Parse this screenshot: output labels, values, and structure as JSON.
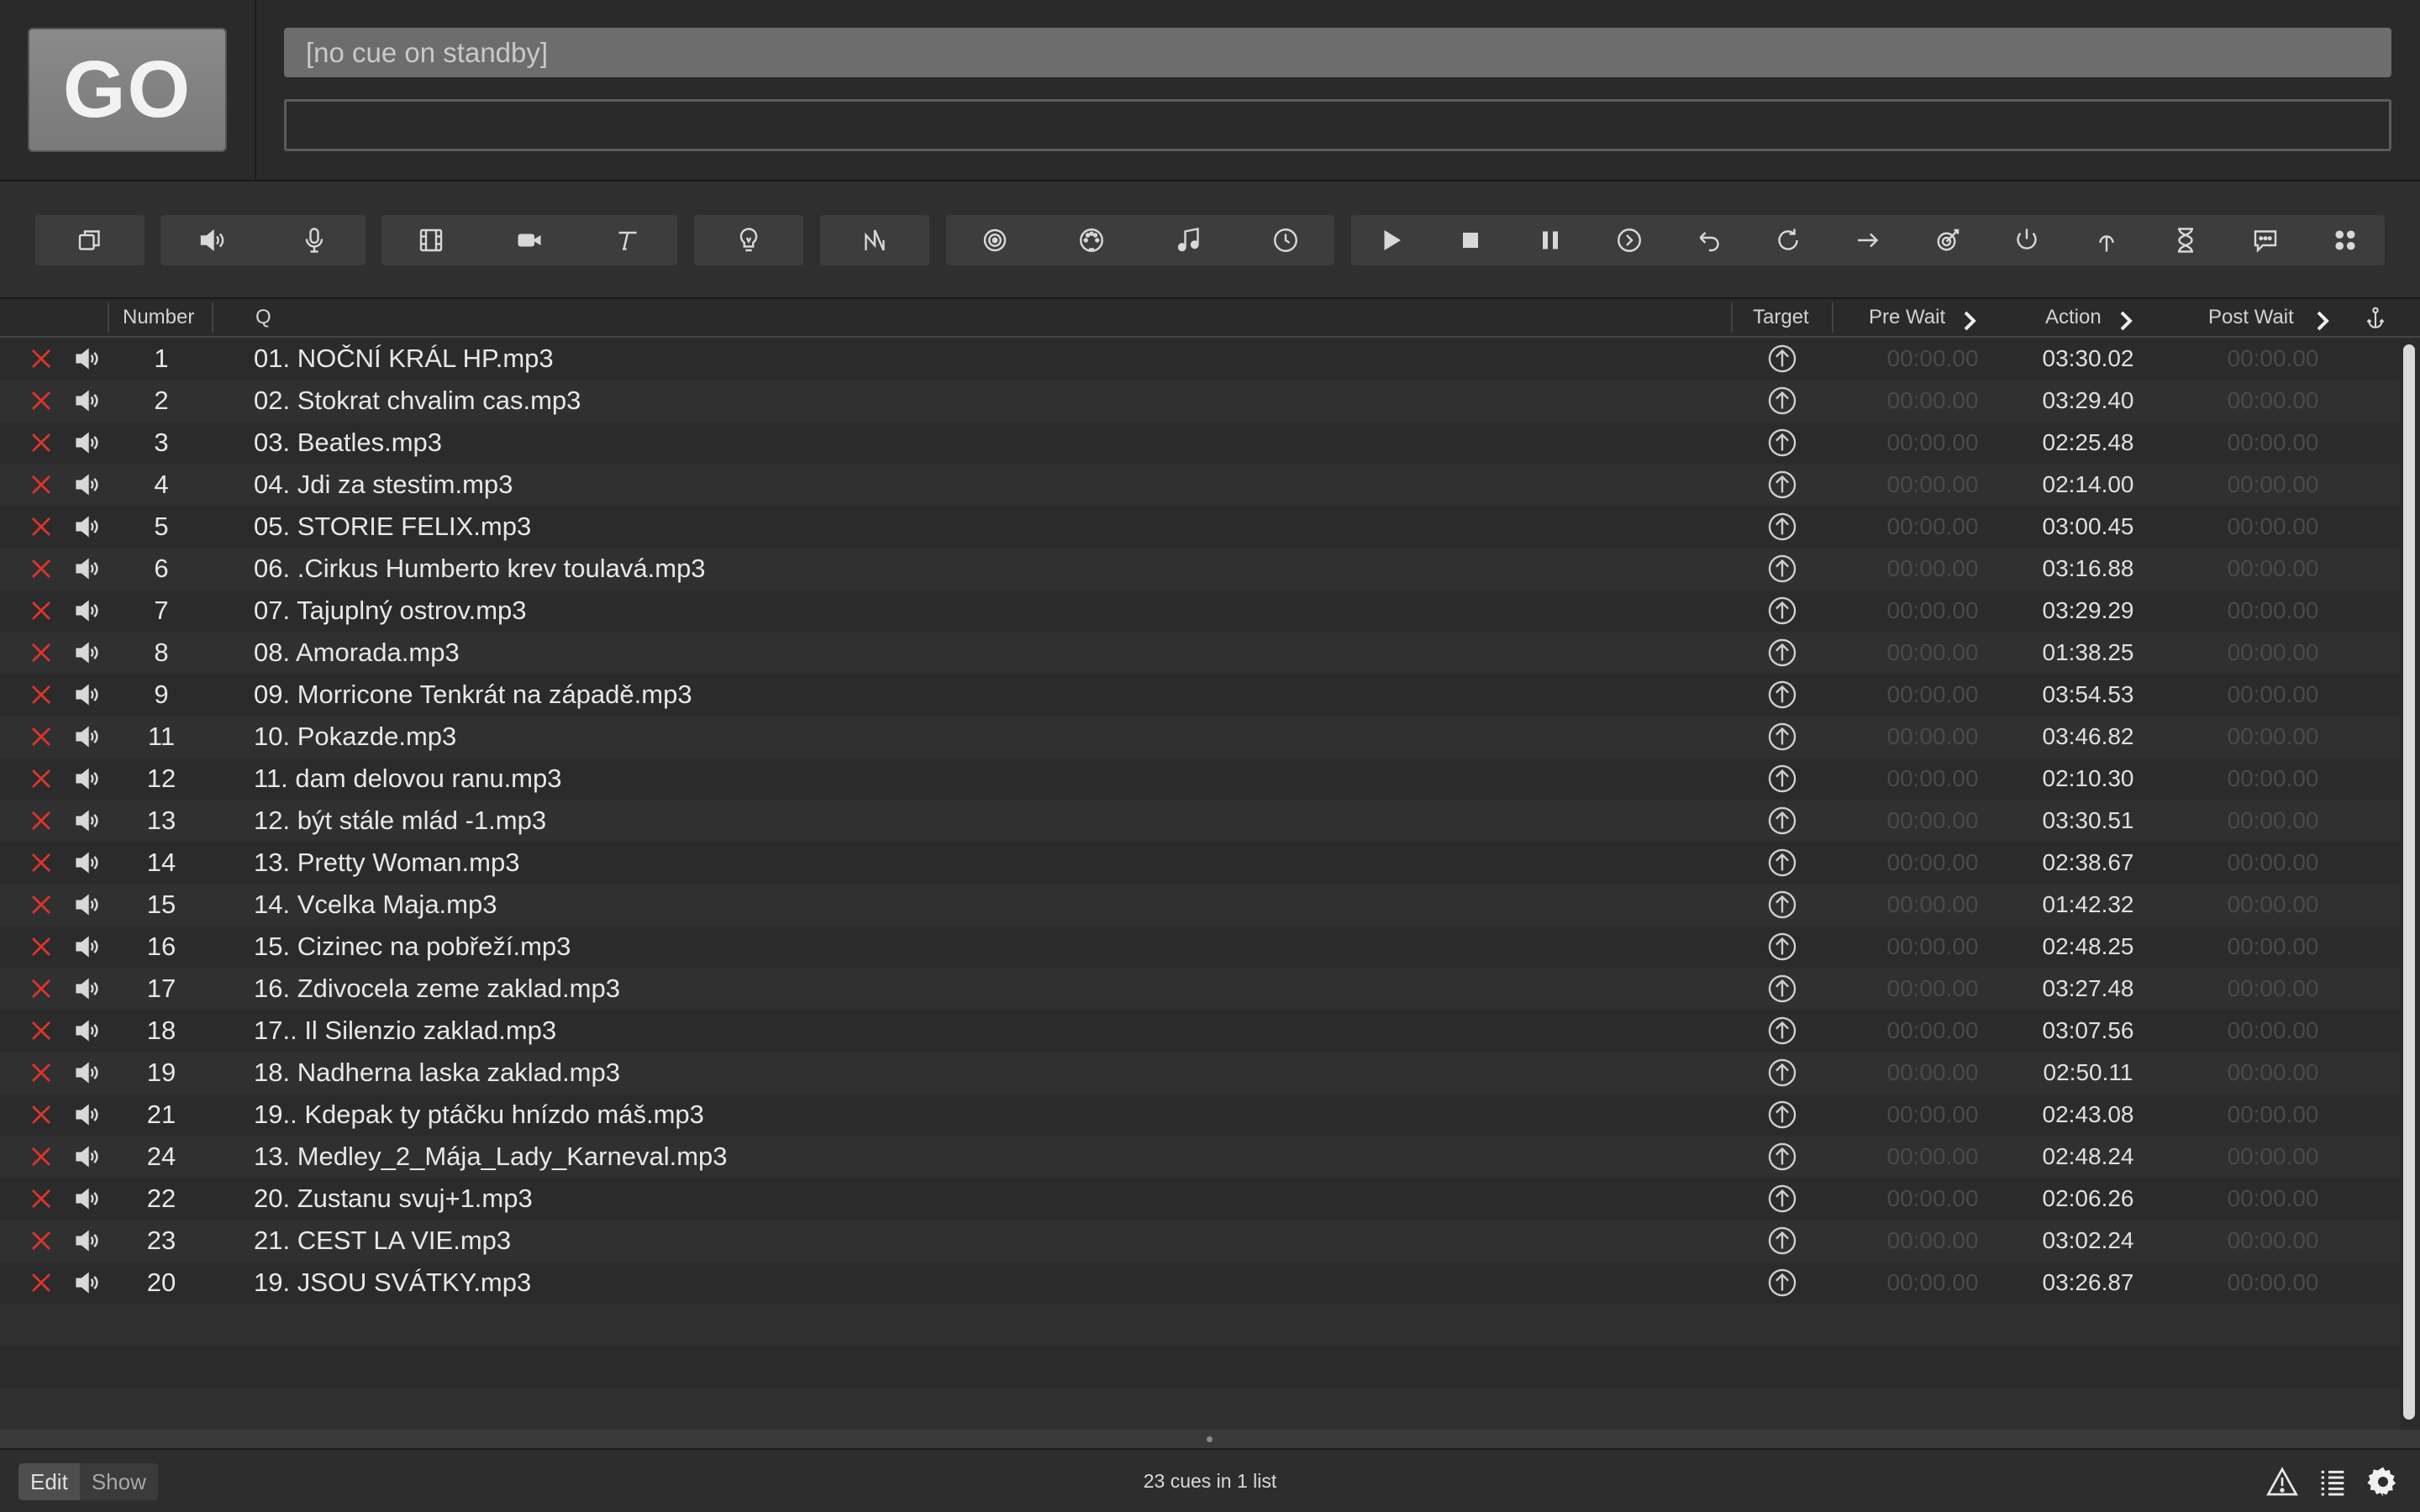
{
  "go_label": "GO",
  "standby_text": "[no cue on standby]",
  "notes_value": "",
  "columns": {
    "number": "Number",
    "q": "Q",
    "target": "Target",
    "prewait": "Pre Wait",
    "action": "Action",
    "postwait": "Post Wait"
  },
  "cues": [
    {
      "number": "1",
      "q": "01. NOČNÍ KRÁL HP.mp3",
      "prewait": "00:00.00",
      "action": "03:30.02",
      "postwait": "00:00.00"
    },
    {
      "number": "2",
      "q": "02. Stokrat chvalim cas.mp3",
      "prewait": "00:00.00",
      "action": "03:29.40",
      "postwait": "00:00.00"
    },
    {
      "number": "3",
      "q": "03. Beatles.mp3",
      "prewait": "00:00.00",
      "action": "02:25.48",
      "postwait": "00:00.00"
    },
    {
      "number": "4",
      "q": "04. Jdi za stestim.mp3",
      "prewait": "00:00.00",
      "action": "02:14.00",
      "postwait": "00:00.00"
    },
    {
      "number": "5",
      "q": "05. STORIE FELIX.mp3",
      "prewait": "00:00.00",
      "action": "03:00.45",
      "postwait": "00:00.00"
    },
    {
      "number": "6",
      "q": "06. .Cirkus Humberto krev toulavá.mp3",
      "prewait": "00:00.00",
      "action": "03:16.88",
      "postwait": "00:00.00"
    },
    {
      "number": "7",
      "q": "07. Tajuplný ostrov.mp3",
      "prewait": "00:00.00",
      "action": "03:29.29",
      "postwait": "00:00.00"
    },
    {
      "number": "8",
      "q": "08. Amorada.mp3",
      "prewait": "00:00.00",
      "action": "01:38.25",
      "postwait": "00:00.00"
    },
    {
      "number": "9",
      "q": "09. Morricone Tenkrát na západě.mp3",
      "prewait": "00:00.00",
      "action": "03:54.53",
      "postwait": "00:00.00"
    },
    {
      "number": "11",
      "q": "10. Pokazde.mp3",
      "prewait": "00:00.00",
      "action": "03:46.82",
      "postwait": "00:00.00"
    },
    {
      "number": "12",
      "q": "11. dam delovou ranu.mp3",
      "prewait": "00:00.00",
      "action": "02:10.30",
      "postwait": "00:00.00"
    },
    {
      "number": "13",
      "q": "12. být stále mlád -1.mp3",
      "prewait": "00:00.00",
      "action": "03:30.51",
      "postwait": "00:00.00"
    },
    {
      "number": "14",
      "q": "13. Pretty Woman.mp3",
      "prewait": "00:00.00",
      "action": "02:38.67",
      "postwait": "00:00.00"
    },
    {
      "number": "15",
      "q": "14. Vcelka Maja.mp3",
      "prewait": "00:00.00",
      "action": "01:42.32",
      "postwait": "00:00.00"
    },
    {
      "number": "16",
      "q": "15. Cizinec na pobřeží.mp3",
      "prewait": "00:00.00",
      "action": "02:48.25",
      "postwait": "00:00.00"
    },
    {
      "number": "17",
      "q": "16. Zdivocela zeme zaklad.mp3",
      "prewait": "00:00.00",
      "action": "03:27.48",
      "postwait": "00:00.00"
    },
    {
      "number": "18",
      "q": "17.. Il Silenzio zaklad.mp3",
      "prewait": "00:00.00",
      "action": "03:07.56",
      "postwait": "00:00.00"
    },
    {
      "number": "19",
      "q": "18. Nadherna laska zaklad.mp3",
      "prewait": "00:00.00",
      "action": "02:50.11",
      "postwait": "00:00.00"
    },
    {
      "number": "21",
      "q": "19.. Kdepak ty ptáčku hnízdo máš.mp3",
      "prewait": "00:00.00",
      "action": "02:43.08",
      "postwait": "00:00.00"
    },
    {
      "number": "24",
      "q": "13. Medley_2_Mája_Lady_Karneval.mp3",
      "prewait": "00:00.00",
      "action": "02:48.24",
      "postwait": "00:00.00"
    },
    {
      "number": "22",
      "q": "20. Zustanu svuj+1.mp3",
      "prewait": "00:00.00",
      "action": "02:06.26",
      "postwait": "00:00.00"
    },
    {
      "number": "23",
      "q": "21. CEST LA VIE.mp3",
      "prewait": "00:00.00",
      "action": "03:02.24",
      "postwait": "00:00.00"
    },
    {
      "number": "20",
      "q": "19. JSOU SVÁTKY.mp3",
      "prewait": "00:00.00",
      "action": "03:26.87",
      "postwait": "00:00.00"
    }
  ],
  "footer": {
    "edit_label": "Edit",
    "show_label": "Show",
    "summary": "23 cues in 1 list"
  },
  "colors": {
    "status_x": "#e0342c",
    "icon": "#d8d8d8"
  },
  "toolbar_icons": [
    [
      "group-icon"
    ],
    [
      "audio-icon",
      "mic-icon"
    ],
    [
      "video-icon",
      "camera-icon",
      "text-icon"
    ],
    [
      "light-icon"
    ],
    [
      "fade-icon"
    ],
    [
      "network-icon",
      "midi-icon",
      "music-icon",
      "timecode-icon"
    ],
    [
      "start-icon",
      "stop-icon",
      "pause-icon",
      "load-icon",
      "reset-icon",
      "devamp-icon",
      "goto-icon",
      "target-icon",
      "arm-icon",
      "disarm-icon",
      "wait-icon",
      "memo-icon",
      "script-icon"
    ]
  ]
}
